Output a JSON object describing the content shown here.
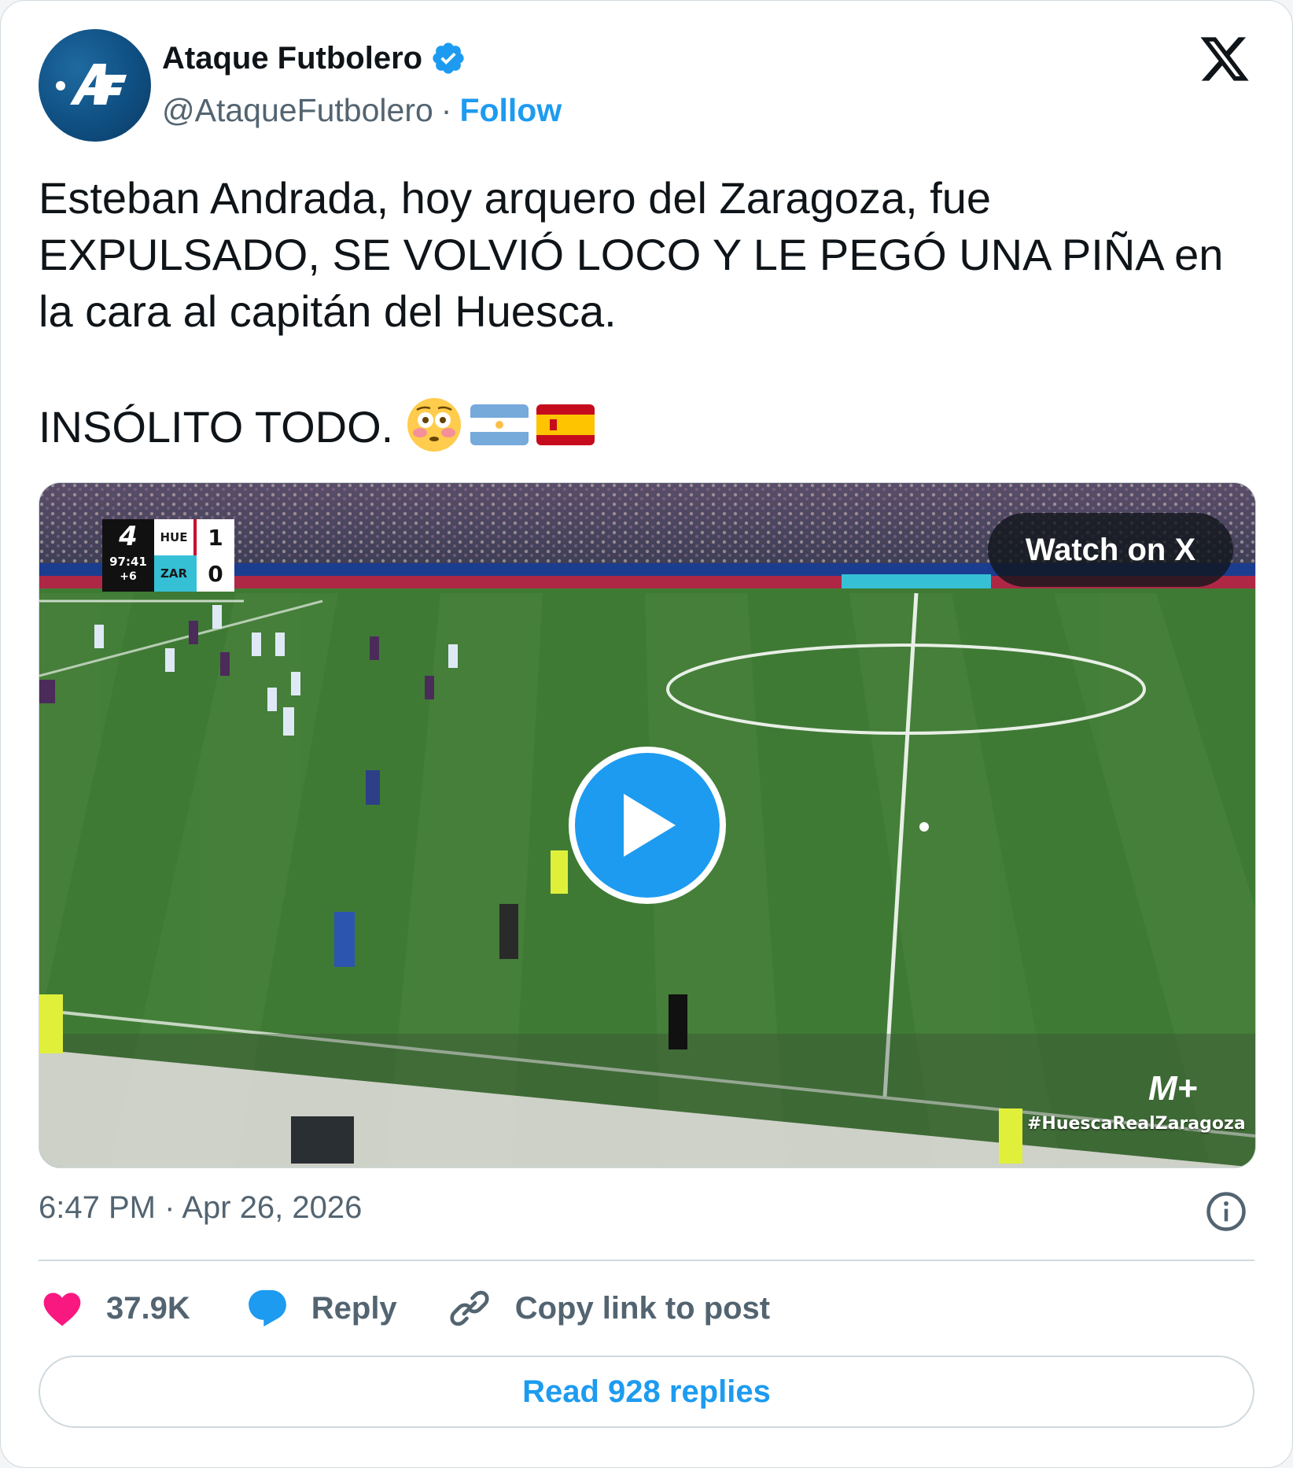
{
  "author": {
    "name": "Ataque Futbolero",
    "handle": "@AtaqueFutbolero",
    "separator": "·",
    "follow_label": "Follow",
    "avatar_text": "AF",
    "verified_icon": "verified-badge-icon"
  },
  "platform_icon": "x-logo-icon",
  "tweet": {
    "paragraph_1": "Esteban Andrada, hoy arquero del Zaragoza, fue EXPULSADO, SE VOLVIÓ LOCO Y LE PEGÓ UNA PIÑA en la cara al capitán del Huesca.",
    "paragraph_2": "INSÓLITO TODO.",
    "emojis": [
      "flushed-face-emoji",
      "argentina-flag-emoji",
      "spain-flag-emoji"
    ]
  },
  "media": {
    "watch_label": "Watch on X",
    "scoreboard": {
      "clock": "97:41",
      "added_time": "+6",
      "home_team": "HUE",
      "home_score": "1",
      "away_team": "ZAR",
      "away_score": "0"
    },
    "broadcaster": "M+",
    "hashtag": "#HuescaRealZaragoza"
  },
  "timestamp": {
    "time": "6:47 PM",
    "separator": "·",
    "date": "Apr 26, 2026"
  },
  "actions": {
    "likes": "37.9K",
    "reply_label": "Reply",
    "copy_label": "Copy link to post"
  },
  "read_replies_label": "Read 928 replies",
  "colors": {
    "accent": "#1d9bf0",
    "like": "#f91880",
    "text": "#0f1419",
    "muted": "#536471",
    "border": "#cfd9de"
  }
}
